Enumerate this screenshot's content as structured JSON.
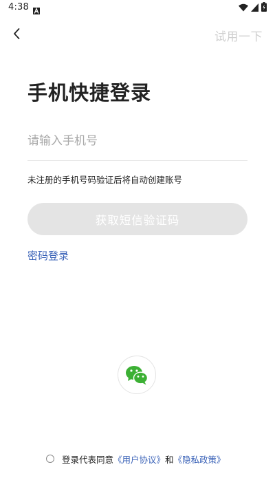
{
  "status_bar": {
    "time": "4:38",
    "icons": [
      "a-notification-icon",
      "wifi-icon",
      "cellular-signal-icon",
      "battery-icon"
    ]
  },
  "header": {
    "back_icon": "chevron-left-icon",
    "try_label": "试用一下"
  },
  "title": "手机快捷登录",
  "phone": {
    "placeholder": "请输入手机号",
    "value": ""
  },
  "hint": "未注册的手机号码验证后将自动创建账号",
  "sms_button_label": "获取短信验证码",
  "password_login_label": "密码登录",
  "wechat": {
    "icon": "wechat-icon"
  },
  "agreement": {
    "prefix": "登录代表同意",
    "user_agreement": "《用户协议》",
    "and": "和",
    "privacy_policy": "《隐私政策》"
  },
  "colors": {
    "link": "#3b63b8",
    "disabled_button_bg": "#e4e4e4",
    "wechat_green": "#3cb034",
    "muted_text": "#cfcfcf"
  }
}
